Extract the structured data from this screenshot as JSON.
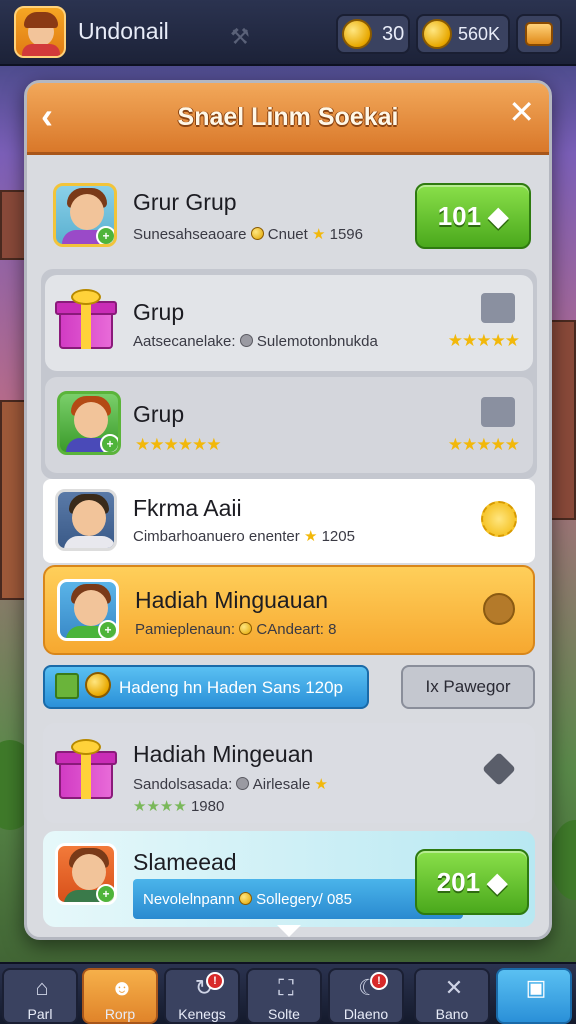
{
  "topbar": {
    "player_name": "Undonail",
    "coins_1": "30",
    "coins_2": "560K"
  },
  "panel": {
    "title": "Snael Linm Soekai",
    "back_icon": "chevron-left-icon",
    "close_icon": "close-icon"
  },
  "rows": [
    {
      "title": "Grur Grup",
      "sub_left": "Sunesahseaoare",
      "sub_mid": "Cnuet",
      "sub_right": "1596",
      "button": "101 ◆"
    },
    {
      "title": "Grup",
      "sub_left": "Aatsecanelake:",
      "sub_mid": "Sulemotonbnukda"
    },
    {
      "title": "Grup"
    },
    {
      "title": "Fkrma Aaii",
      "sub_left": "Cimbarhoanuero enenter",
      "sub_right": "1205"
    },
    {
      "title": "Hadiah Minguauan",
      "sub_left": "Pamieplenaun:",
      "sub_mid": "CAndeart: 8"
    },
    {
      "title": "Hadiah Mingeuan",
      "sub_left": "Sandolsasada:",
      "sub_mid": "Airlesale",
      "sub_right": "1980"
    },
    {
      "title": "Slameead",
      "sub_left": "Nevolelnpann",
      "sub_mid": "Sollegery/ 085",
      "button": "201 ◆"
    }
  ],
  "banner": {
    "text": "Hadeng hn Haden Sans 120p",
    "secondary_button": "Ix Pawegor"
  },
  "nav": [
    {
      "label": "Parl",
      "icon": "home-icon"
    },
    {
      "label": "Rorp",
      "icon": "profile-icon"
    },
    {
      "label": "Kenegs",
      "icon": "refresh-icon",
      "badge": "!"
    },
    {
      "label": "Solte",
      "icon": "shop-icon"
    },
    {
      "label": "Dlaeno",
      "icon": "moon-icon",
      "badge": "!"
    },
    {
      "label": "Bano",
      "icon": "tools-icon"
    },
    {
      "label": "",
      "icon": "chest-icon"
    }
  ],
  "colors": {
    "accent_orange": "#e08a3a",
    "button_green": "#5cbc2a",
    "highlight_yellow": "#fbbd3c",
    "banner_blue": "#3aa8e8"
  }
}
